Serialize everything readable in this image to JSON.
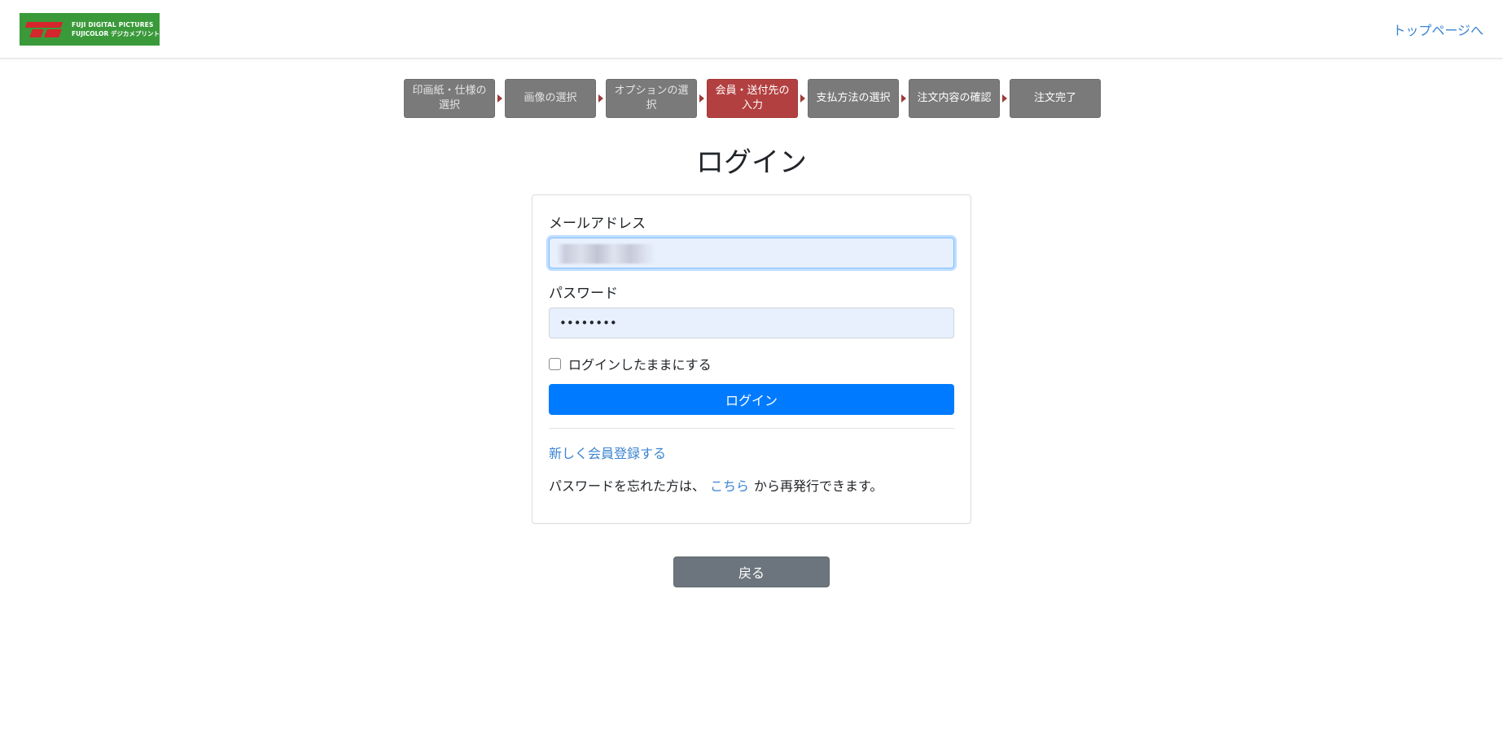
{
  "header": {
    "logo": {
      "line1": "FUJI DIGITAL PICTURES",
      "line2": "FUJICOLOR デジカメプリント"
    },
    "top_link": "トップページへ"
  },
  "steps": [
    {
      "label": "印画紙・仕様の選択",
      "state": "done"
    },
    {
      "label": "画像の選択",
      "state": "done"
    },
    {
      "label": "オプションの選択",
      "state": "done"
    },
    {
      "label": "会員・送付先の入力",
      "state": "active"
    },
    {
      "label": "支払方法の選択",
      "state": "todo"
    },
    {
      "label": "注文内容の確認",
      "state": "todo"
    },
    {
      "label": "注文完了",
      "state": "todo"
    }
  ],
  "page_title": "ログイン",
  "form": {
    "email_label": "メールアドレス",
    "email_value": "",
    "password_label": "パスワード",
    "password_value": "••••••••",
    "remember_label": "ログインしたままにする",
    "remember_checked": false,
    "submit_label": "ログイン",
    "register_link": "新しく会員登録する",
    "forgot_prefix": "パスワードを忘れた方は、",
    "forgot_link": "こちら",
    "forgot_suffix": "から再発行できます。"
  },
  "back_label": "戻る",
  "colors": {
    "primary": "#007bff",
    "step_active": "#b34040",
    "step_default": "#7a7a7a",
    "link": "#3b84d1",
    "secondary_button": "#6c757d",
    "logo_bg": "#3a9a3a"
  }
}
